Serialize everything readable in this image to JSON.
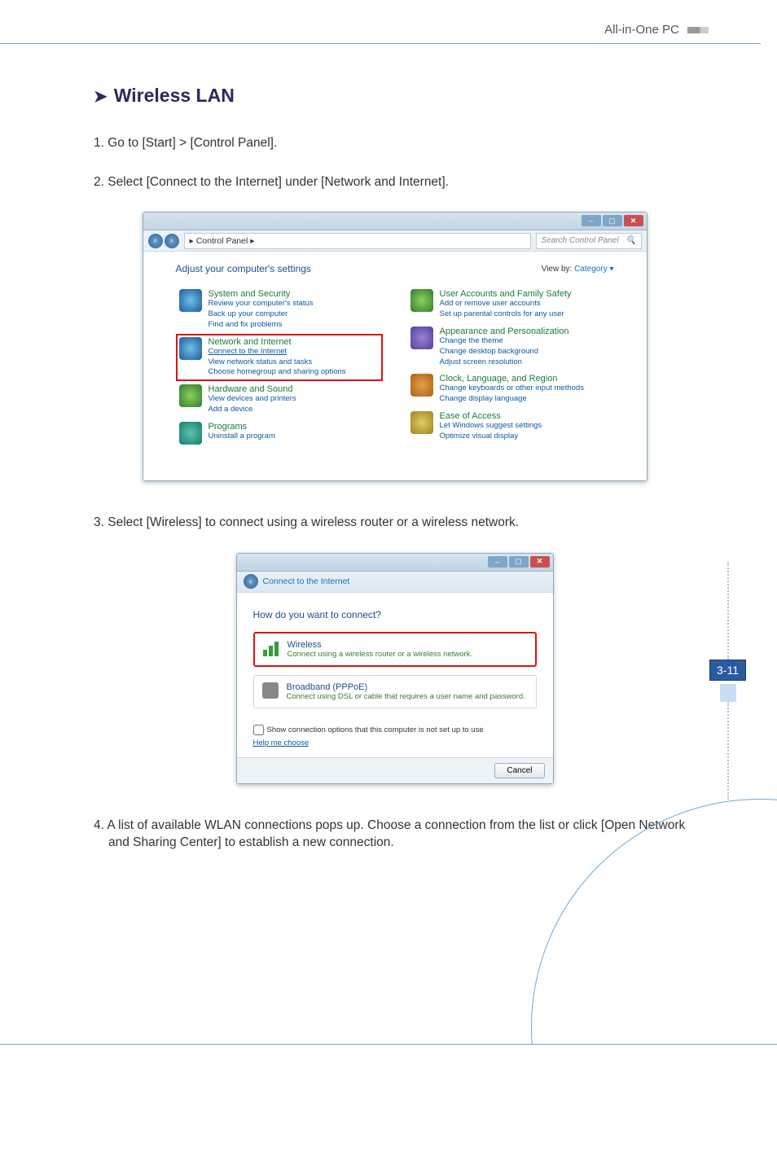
{
  "page": {
    "header_label": "All-in-One PC",
    "page_number": "3-11",
    "section_title": "Wireless LAN",
    "steps": {
      "s1": "1. Go to [Start] > [Control Panel].",
      "s2": "2. Select [Connect to the Internet] under [Network and Internet].",
      "s3": "3. Select [Wireless] to connect using a wireless router or a wireless network.",
      "s4": "4. A list of available WLAN connections pops up. Choose a connection from the list or click [Open Network and Sharing Center] to establish a new connection."
    }
  },
  "cp_window": {
    "breadcrumb": "▸ Control Panel ▸",
    "search_placeholder": "Search Control Panel",
    "heading": "Adjust your computer's settings",
    "viewby_label": "View by:",
    "viewby_value": "Category ▾",
    "win_btns": {
      "min": "–",
      "max": "▢",
      "close": "✕"
    },
    "categories": {
      "system": {
        "title": "System and Security",
        "links": [
          "Review your computer's status",
          "Back up your computer",
          "Find and fix problems"
        ]
      },
      "network": {
        "title": "Network and Internet",
        "links": [
          "Connect to the Internet",
          "View network status and tasks",
          "Choose homegroup and sharing options"
        ]
      },
      "hardware": {
        "title": "Hardware and Sound",
        "links": [
          "View devices and printers",
          "Add a device"
        ]
      },
      "programs": {
        "title": "Programs",
        "links": [
          "Uninstall a program"
        ]
      },
      "users": {
        "title": "User Accounts and Family Safety",
        "links": [
          "Add or remove user accounts",
          "Set up parental controls for any user"
        ]
      },
      "appearance": {
        "title": "Appearance and Personalization",
        "links": [
          "Change the theme",
          "Change desktop background",
          "Adjust screen resolution"
        ]
      },
      "clock": {
        "title": "Clock, Language, and Region",
        "links": [
          "Change keyboards or other input methods",
          "Change display language"
        ]
      },
      "ease": {
        "title": "Ease of Access",
        "links": [
          "Let Windows suggest settings",
          "Optimize visual display"
        ]
      }
    }
  },
  "wiz_window": {
    "breadcrumb": "Connect to the Internet",
    "question": "How do you want to connect?",
    "win_btns": {
      "min": "–",
      "max": "▢",
      "close": "✕"
    },
    "options": {
      "wireless": {
        "title": "Wireless",
        "desc": "Connect using a wireless router or a wireless network."
      },
      "broadband": {
        "title": "Broadband (PPPoE)",
        "desc": "Connect using DSL or cable that requires a user name and password."
      }
    },
    "checkbox_label": "Show connection options that this computer is not set up to use",
    "help_link": "Help me choose",
    "cancel": "Cancel"
  }
}
